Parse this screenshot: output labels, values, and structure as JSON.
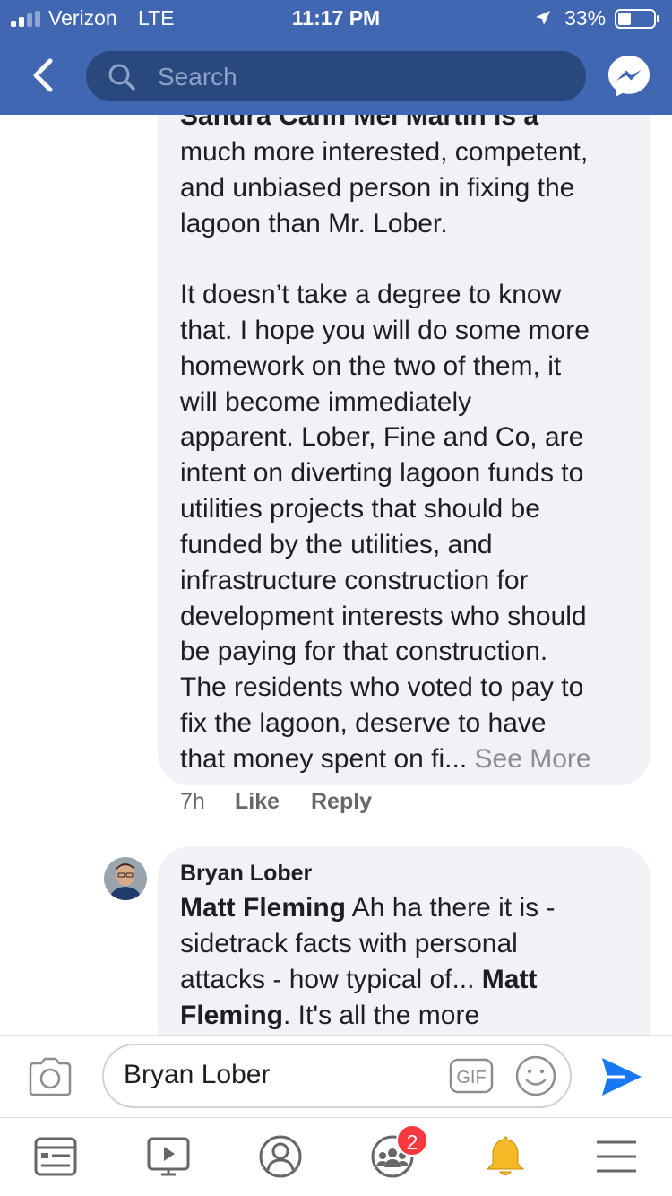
{
  "status_bar": {
    "carrier": "Verizon",
    "network": "LTE",
    "time": "11:17 PM",
    "battery": "33%"
  },
  "header": {
    "search_placeholder": "Search"
  },
  "comment1": {
    "partial_top": "Sandra Cahn Mel Martin is a",
    "lines": [
      "much more interested, competent,",
      "and unbiased person in fixing the",
      "lagoon than Mr. Lober.",
      "",
      "It doesn’t take a degree to know",
      "that. I hope you will do some more",
      "homework on the two of them, it",
      "will become immediately",
      "apparent. Lober, Fine and Co, are",
      "intent on diverting lagoon funds to",
      "utilities projects that should be",
      "funded by the utilities, and",
      "infrastructure  construction for",
      "development interests who should",
      "be paying for that construction.",
      "The residents who voted to pay to",
      "fix the lagoon, deserve to have"
    ],
    "last_line": "that money spent on fi...",
    "see_more": "See More",
    "time": "7h",
    "like": "Like",
    "reply": "Reply"
  },
  "comment2": {
    "author": "Bryan Lober",
    "mention1": "Matt Fleming",
    "line1_rest": " Ah ha there it is -",
    "line2": "sidetrack facts with personal",
    "line3_start": "attacks - how typical of... ",
    "mention2_part1": "Matt",
    "mention2_part2": "Fleming",
    "line4_rest": ". It's all the more"
  },
  "composer": {
    "input_value": "Bryan Lober",
    "gif_label": "GIF"
  },
  "nav": {
    "groups_badge": "2"
  },
  "colors": {
    "brand": "#4267b2",
    "search_bg": "#29487d",
    "bubble": "#f0f2f5",
    "send": "#1877f2",
    "badge": "#fa383e"
  }
}
